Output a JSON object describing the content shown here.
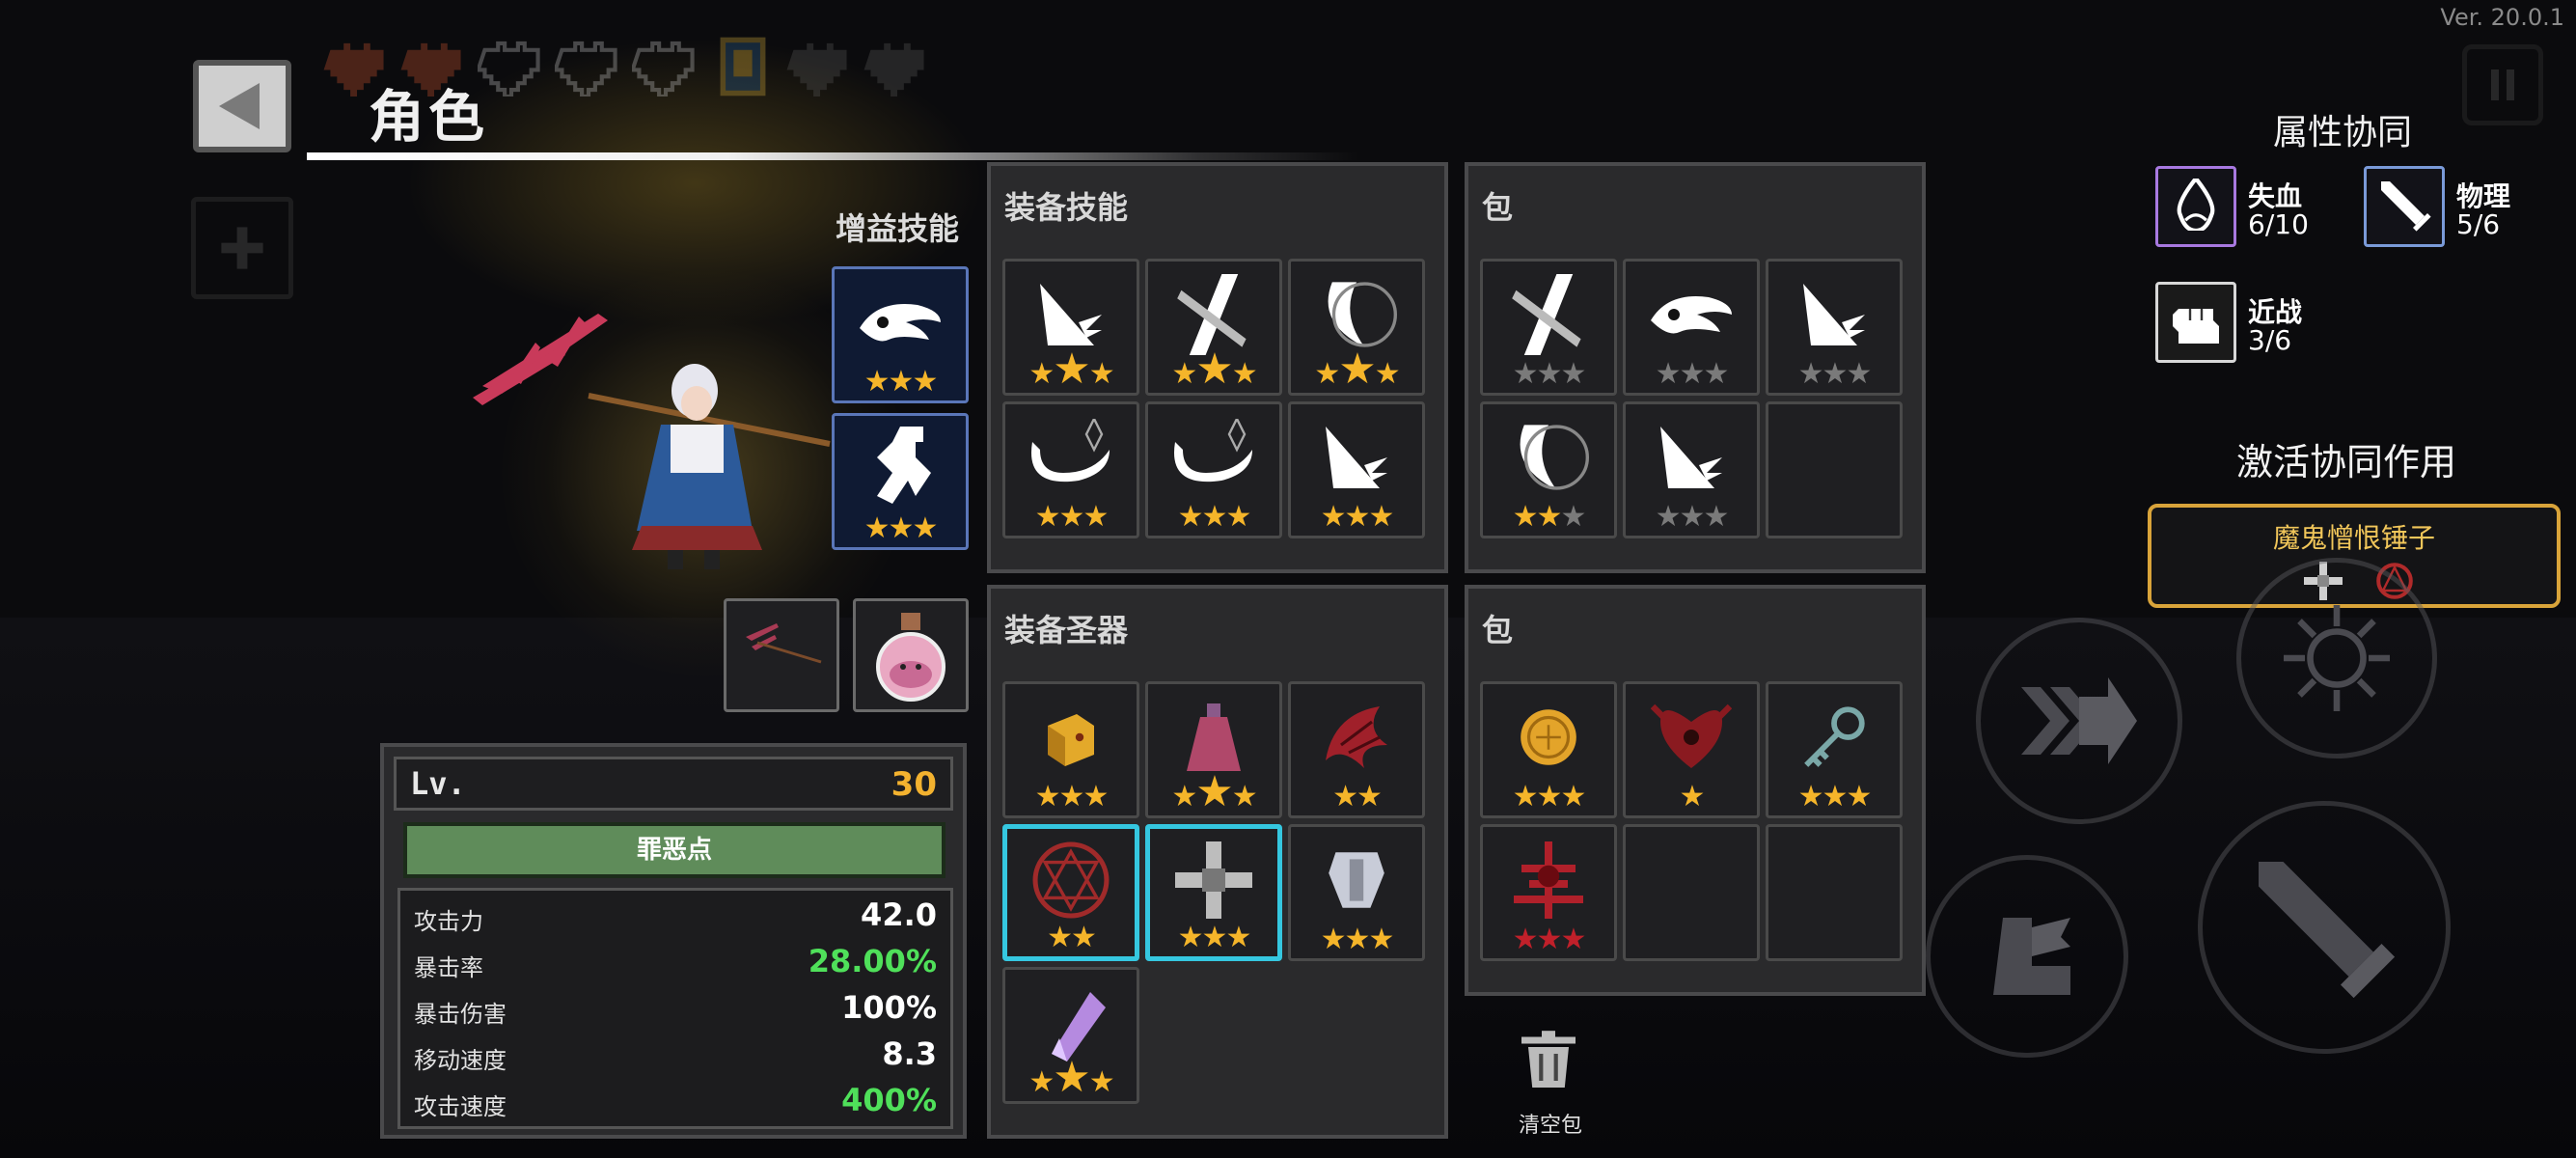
{
  "version": "Ver. 20.0.1",
  "header": {
    "title": "角色",
    "back_icon": "back-arrow-icon",
    "add_icon": "plus-icon",
    "pause_icon": "pause-icon"
  },
  "buff_skills": {
    "label": "增益技能",
    "slots": [
      {
        "icon": "slash-wave-icon",
        "stars": 3,
        "star_color": "gold"
      },
      {
        "icon": "white-figure-icon",
        "stars": 3,
        "star_color": "gold"
      }
    ]
  },
  "weapon_slots": [
    {
      "icon": "scythe-weapon-icon"
    },
    {
      "icon": "pink-potion-icon"
    }
  ],
  "equipped_skills": {
    "title": "装备技能",
    "slots": [
      {
        "icon": "slash-burst-icon",
        "stars": 3,
        "big_middle": true
      },
      {
        "icon": "x-slash-icon",
        "stars": 3,
        "big_middle": true
      },
      {
        "icon": "crescent-slash-icon",
        "stars": 3,
        "big_middle": true
      },
      {
        "icon": "swirl-slash-icon",
        "stars": 3,
        "big_middle": false
      },
      {
        "icon": "swirl-slash-icon",
        "stars": 3,
        "big_middle": false
      },
      {
        "icon": "slash-burst-icon",
        "stars": 3,
        "big_middle": false
      }
    ]
  },
  "skill_bag": {
    "title": "包",
    "slots": [
      {
        "icon": "x-slash-icon",
        "stars": 3,
        "gold": 0
      },
      {
        "icon": "slash-wave-icon",
        "stars": 3,
        "gold": 0
      },
      {
        "icon": "slash-burst-icon",
        "stars": 3,
        "gold": 0
      },
      {
        "icon": "crescent-slash-icon",
        "stars": 3,
        "gold": 2
      },
      {
        "icon": "slash-burst-icon",
        "stars": 3,
        "gold": 0
      },
      {
        "icon": "",
        "stars": 0,
        "gold": 0
      }
    ]
  },
  "equipped_relics": {
    "title": "装备圣器",
    "slots": [
      {
        "icon": "golden-dice-icon",
        "stars": 3,
        "big_middle": false,
        "highlight": false
      },
      {
        "icon": "red-cloak-icon",
        "stars": 3,
        "big_middle": true,
        "highlight": false
      },
      {
        "icon": "red-claw-icon",
        "stars": 2,
        "big_middle": false,
        "highlight": false
      },
      {
        "icon": "demon-seal-icon",
        "stars": 2,
        "big_middle": false,
        "highlight": true
      },
      {
        "icon": "iron-cross-icon",
        "stars": 3,
        "big_middle": false,
        "highlight": true
      },
      {
        "icon": "silver-armor-icon",
        "stars": 3,
        "big_middle": false,
        "highlight": false
      },
      {
        "icon": "purple-crystal-icon",
        "stars": 3,
        "big_middle": true,
        "highlight": false
      }
    ]
  },
  "relic_bag": {
    "title": "包",
    "slots": [
      {
        "icon": "gold-coin-icon",
        "stars": 3,
        "color": "gold"
      },
      {
        "icon": "demon-heart-icon",
        "stars": 1,
        "color": "gold"
      },
      {
        "icon": "teal-key-icon",
        "stars": 3,
        "color": "gold"
      },
      {
        "icon": "red-totem-icon",
        "stars": 3,
        "color": "red"
      },
      {
        "icon": "",
        "stars": 0,
        "color": "gold"
      },
      {
        "icon": "",
        "stars": 0,
        "color": "gold"
      }
    ]
  },
  "stats": {
    "lv_label": "Lv.",
    "lv_value": "30",
    "sin_button": "罪恶点",
    "rows": [
      {
        "name": "攻击力",
        "value": "42.0",
        "color": "#ffffff"
      },
      {
        "name": "暴击率",
        "value": "28.00%",
        "color": "#4fe05a"
      },
      {
        "name": "暴击伤害",
        "value": "100%",
        "color": "#ffffff"
      },
      {
        "name": "移动速度",
        "value": "8.3",
        "color": "#ffffff"
      },
      {
        "name": "攻击速度",
        "value": "400%",
        "color": "#4fe05a"
      }
    ]
  },
  "synergy": {
    "title": "属性协同",
    "items": [
      {
        "name": "失血",
        "count": "6/10",
        "icon": "blood-drop-icon",
        "border": "#a879e0"
      },
      {
        "name": "物理",
        "count": "5/6",
        "icon": "sword-icon",
        "border": "#7a9ad8"
      },
      {
        "name": "近战",
        "count": "3/6",
        "icon": "fist-icon",
        "border": "#d8d8d8"
      }
    ],
    "activate_title": "激活协同作用",
    "active": {
      "name": "魔鬼憎恨锤子",
      "icons": [
        "iron-cross-icon",
        "demon-seal-icon"
      ]
    }
  },
  "clear_bag": {
    "label": "清空包",
    "icon": "trash-icon"
  },
  "controls": [
    "dash-icon",
    "burst-icon",
    "winged-boot-icon",
    "attack-sword-icon"
  ]
}
